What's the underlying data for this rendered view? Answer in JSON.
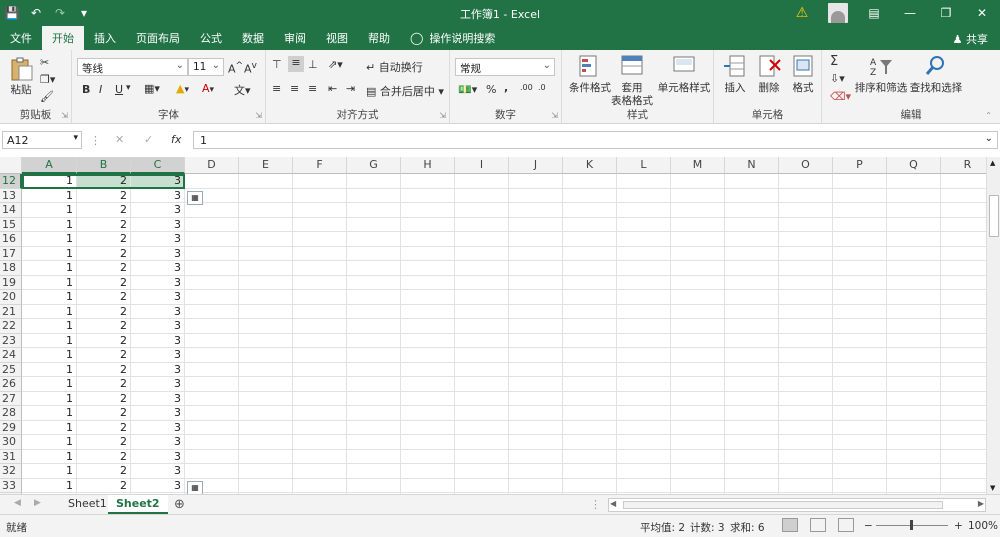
{
  "window": {
    "title": "工作簿1 - Excel"
  },
  "menu": {
    "tabs": [
      "文件",
      "开始",
      "插入",
      "页面布局",
      "公式",
      "数据",
      "审阅",
      "视图",
      "帮助"
    ],
    "tell_me": "操作说明搜索",
    "share": "共享"
  },
  "ribbon": {
    "clipboard": {
      "paste": "粘贴",
      "label": "剪贴板"
    },
    "font": {
      "name": "等线",
      "size": "11",
      "label": "字体",
      "bold": "B",
      "italic": "I",
      "underline": "U"
    },
    "alignment": {
      "wrap": "自动换行",
      "merge": "合并后居中",
      "label": "对齐方式"
    },
    "number": {
      "format": "常规",
      "label": "数字",
      "percent": "%",
      "comma": ","
    },
    "styles": {
      "conditional": "条件格式",
      "table_format_1": "套用",
      "table_format_2": "表格格式",
      "cell_styles": "单元格样式",
      "label": "样式"
    },
    "cells": {
      "insert": "插入",
      "delete": "删除",
      "format": "格式",
      "label": "单元格"
    },
    "editing": {
      "sort_filter": "排序和筛选",
      "find_select": "查找和选择",
      "label": "编辑",
      "sum": "Σ"
    }
  },
  "formula_bar": {
    "name_box": "A12",
    "fx": "fx",
    "value": "1"
  },
  "grid": {
    "columns": [
      "A",
      "B",
      "C",
      "D",
      "E",
      "F",
      "G",
      "H",
      "I",
      "J",
      "K",
      "L",
      "M",
      "N",
      "O",
      "P",
      "Q",
      "R"
    ],
    "rows": [
      {
        "num": "12",
        "a": "1",
        "b": "2",
        "c": "3"
      },
      {
        "num": "13",
        "a": "1",
        "b": "2",
        "c": "3"
      },
      {
        "num": "14",
        "a": "1",
        "b": "2",
        "c": "3"
      },
      {
        "num": "15",
        "a": "1",
        "b": "2",
        "c": "3"
      },
      {
        "num": "16",
        "a": "1",
        "b": "2",
        "c": "3"
      },
      {
        "num": "17",
        "a": "1",
        "b": "2",
        "c": "3"
      },
      {
        "num": "18",
        "a": "1",
        "b": "2",
        "c": "3"
      },
      {
        "num": "19",
        "a": "1",
        "b": "2",
        "c": "3"
      },
      {
        "num": "20",
        "a": "1",
        "b": "2",
        "c": "3"
      },
      {
        "num": "21",
        "a": "1",
        "b": "2",
        "c": "3"
      },
      {
        "num": "22",
        "a": "1",
        "b": "2",
        "c": "3"
      },
      {
        "num": "23",
        "a": "1",
        "b": "2",
        "c": "3"
      },
      {
        "num": "24",
        "a": "1",
        "b": "2",
        "c": "3"
      },
      {
        "num": "25",
        "a": "1",
        "b": "2",
        "c": "3"
      },
      {
        "num": "26",
        "a": "1",
        "b": "2",
        "c": "3"
      },
      {
        "num": "27",
        "a": "1",
        "b": "2",
        "c": "3"
      },
      {
        "num": "28",
        "a": "1",
        "b": "2",
        "c": "3"
      },
      {
        "num": "29",
        "a": "1",
        "b": "2",
        "c": "3"
      },
      {
        "num": "30",
        "a": "1",
        "b": "2",
        "c": "3"
      },
      {
        "num": "31",
        "a": "1",
        "b": "2",
        "c": "3"
      },
      {
        "num": "32",
        "a": "1",
        "b": "2",
        "c": "3"
      },
      {
        "num": "33",
        "a": "1",
        "b": "2",
        "c": "3"
      }
    ]
  },
  "sheets": [
    "Sheet1",
    "Sheet2"
  ],
  "active_sheet": "Sheet2",
  "status": {
    "mode": "就绪",
    "average": "平均值: 2",
    "count": "计数: 3",
    "sum": "求和: 6",
    "zoom": "100%"
  },
  "colors": {
    "accent": "#217346",
    "selection_fill": "#c6dfce"
  }
}
